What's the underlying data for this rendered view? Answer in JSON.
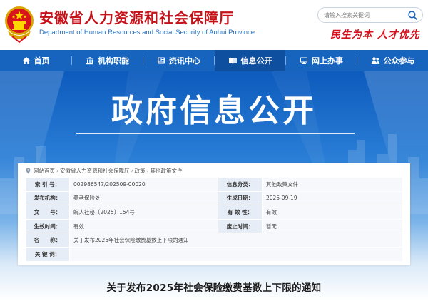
{
  "header": {
    "title": "安徽省人力资源和社会保障厅",
    "subtitle": "Department of Human Resources and Social Security of Anhui Province",
    "search_placeholder": "请输入搜索关键词",
    "slogan": "民生为本  人才优先",
    "brand_red": "#c4121a"
  },
  "nav": {
    "items": [
      {
        "label": "首页",
        "icon": "home-icon"
      },
      {
        "label": "机构职能",
        "icon": "building-icon"
      },
      {
        "label": "资讯中心",
        "icon": "news-icon"
      },
      {
        "label": "信息公开",
        "icon": "open-book-icon"
      },
      {
        "label": "网上办事",
        "icon": "monitor-icon"
      },
      {
        "label": "公众参与",
        "icon": "people-icon"
      }
    ],
    "active": "信息公开",
    "bg_color": "#1764be"
  },
  "banner": {
    "title": "政府信息公开"
  },
  "breadcrumb": [
    "网站首页",
    "安徽省人力资源和社会保障厅",
    "政策",
    "其他政策文件"
  ],
  "info": {
    "rows": [
      {
        "k1": "索 引 号：",
        "v1": "002986547/202509-00020",
        "k2": "信息分类：",
        "v2": "其他政策文件"
      },
      {
        "k1": "发布机构：",
        "v1": "养老保险处",
        "k2": "生成日期：",
        "v2": "2025-09-19"
      },
      {
        "k1": "文　　号：",
        "v1": "皖人社秘〔2025〕154号",
        "k2": "有 效 性：",
        "v2": "有效"
      },
      {
        "k1": "生效时间：",
        "v1": "有效",
        "k2": "废止时间：",
        "v2": "暂无"
      }
    ],
    "name_label": "名　　称：",
    "name_value": "关于发布2025年社会保险缴费基数上下限的通知",
    "keywords_label": "关 键 词：",
    "keywords_value": ""
  },
  "article": {
    "title": "关于发布2025年社会保险缴费基数上下限的通知"
  }
}
